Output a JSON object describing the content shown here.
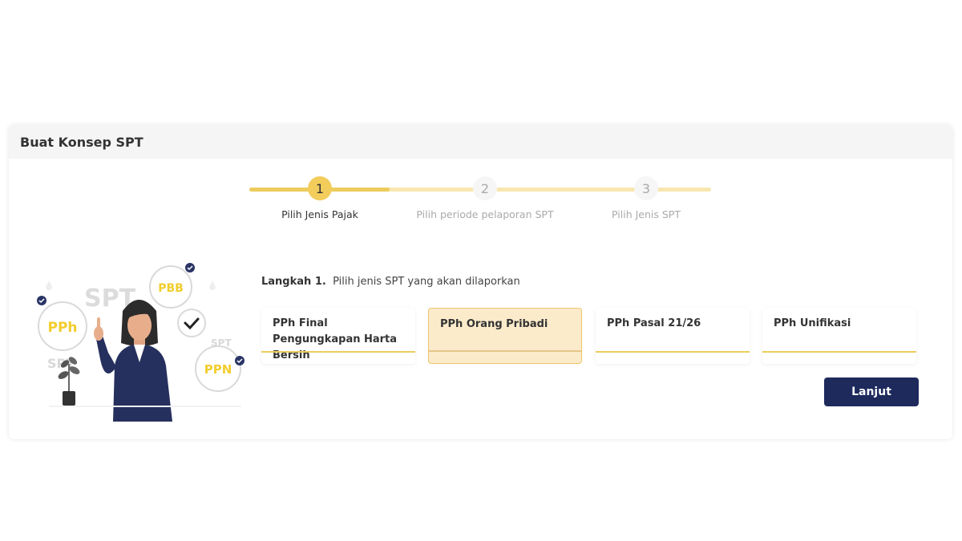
{
  "panel": {
    "title": "Buat Konsep SPT"
  },
  "stepper": {
    "steps": [
      {
        "number": "1",
        "label": "Pilih Jenis Pajak",
        "state": "active"
      },
      {
        "number": "2",
        "label": "Pilih periode pelaporan SPT",
        "state": "idle"
      },
      {
        "number": "3",
        "label": "Pilih Jenis SPT",
        "state": "idle"
      }
    ]
  },
  "illustration": {
    "badges": [
      "PPh",
      "PBB",
      "PPN"
    ],
    "labels": [
      "SPT",
      "SPT",
      "SPT"
    ]
  },
  "main": {
    "step_prefix": "Langkah 1.",
    "step_text": "Pilih jenis SPT yang akan dilaporkan",
    "options": [
      {
        "label": "PPh Final Pengungkapan Harta Bersih",
        "selected": false
      },
      {
        "label": "PPh Orang Pribadi",
        "selected": true
      },
      {
        "label": "PPh Pasal 21/26",
        "selected": false
      },
      {
        "label": "PPh Unifikasi",
        "selected": false
      }
    ],
    "next_button": "Lanjut"
  },
  "colors": {
    "accent_yellow": "#f2cd5c",
    "primary_navy": "#1e2a5c",
    "selected_bg": "#fcebcb"
  }
}
